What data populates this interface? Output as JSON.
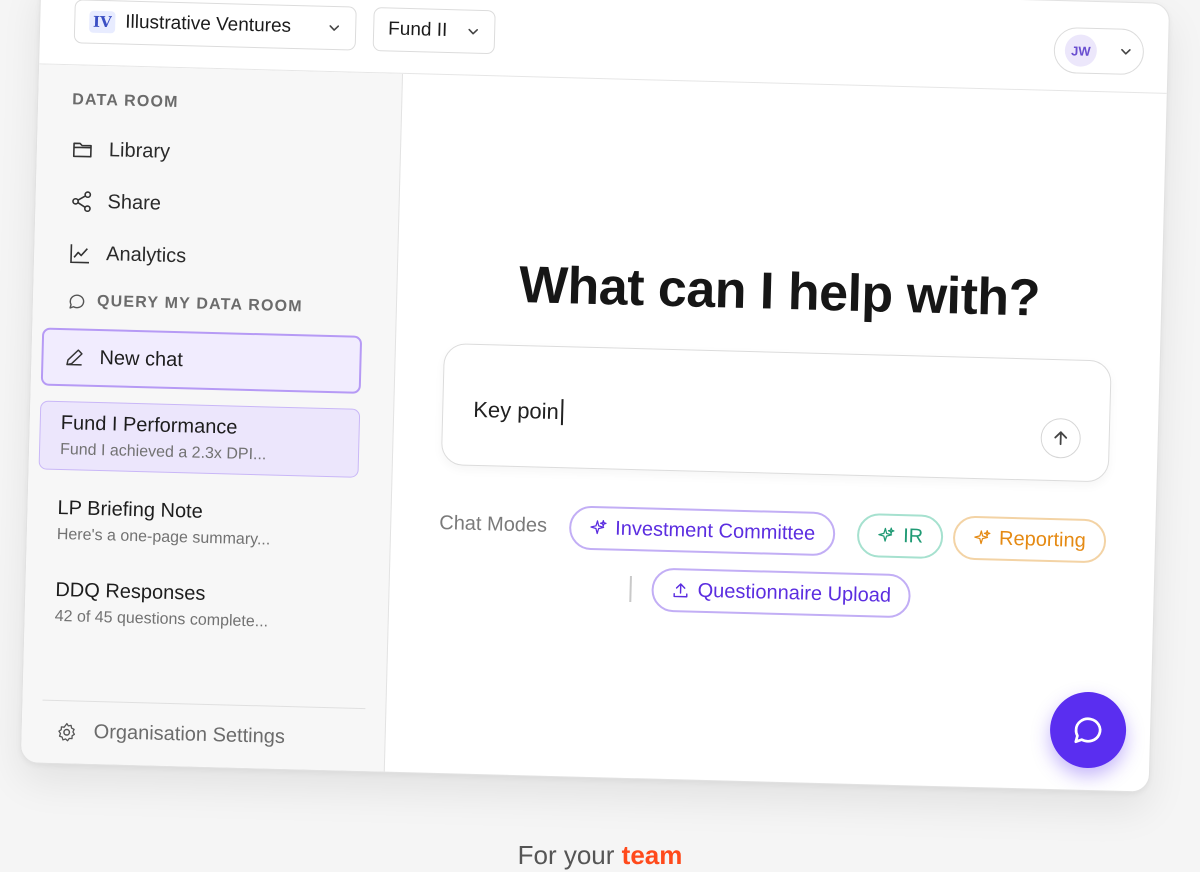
{
  "header": {
    "org_logo": "IV",
    "org_name": "Illustrative Ventures",
    "fund_name": "Fund II",
    "user_initials": "JW"
  },
  "sidebar": {
    "data_room_heading": "DATA ROOM",
    "nav": [
      {
        "label": "Library",
        "icon": "folder-icon"
      },
      {
        "label": "Share",
        "icon": "share-icon"
      },
      {
        "label": "Analytics",
        "icon": "chart-line-icon"
      }
    ],
    "query_heading": "QUERY MY DATA ROOM",
    "new_chat_label": "New chat",
    "chats": [
      {
        "title": "Fund I Performance",
        "preview": "Fund I achieved a 2.3x DPI..."
      },
      {
        "title": "LP Briefing Note",
        "preview": "Here's a one-page summary..."
      },
      {
        "title": "DDQ Responses",
        "preview": "42 of 45 questions complete..."
      }
    ],
    "settings_label": "Organisation Settings"
  },
  "main": {
    "headline": "What can I help with?",
    "prompt_value": "Key poin",
    "modes_label": "Chat Modes",
    "modes": [
      {
        "label": "Investment Committee",
        "color": "#5b2de0"
      },
      {
        "label": "IR",
        "color": "#1f9a74"
      },
      {
        "label": "Reporting",
        "color": "#e58a13"
      },
      {
        "label": "Questionnaire Upload",
        "color": "#5b2de0"
      }
    ]
  },
  "footer": {
    "tagline_prefix": "For your",
    "tagline_accent": "team"
  },
  "colors": {
    "accent": "#5a2ef0",
    "highlight": "#ff4a1c"
  }
}
